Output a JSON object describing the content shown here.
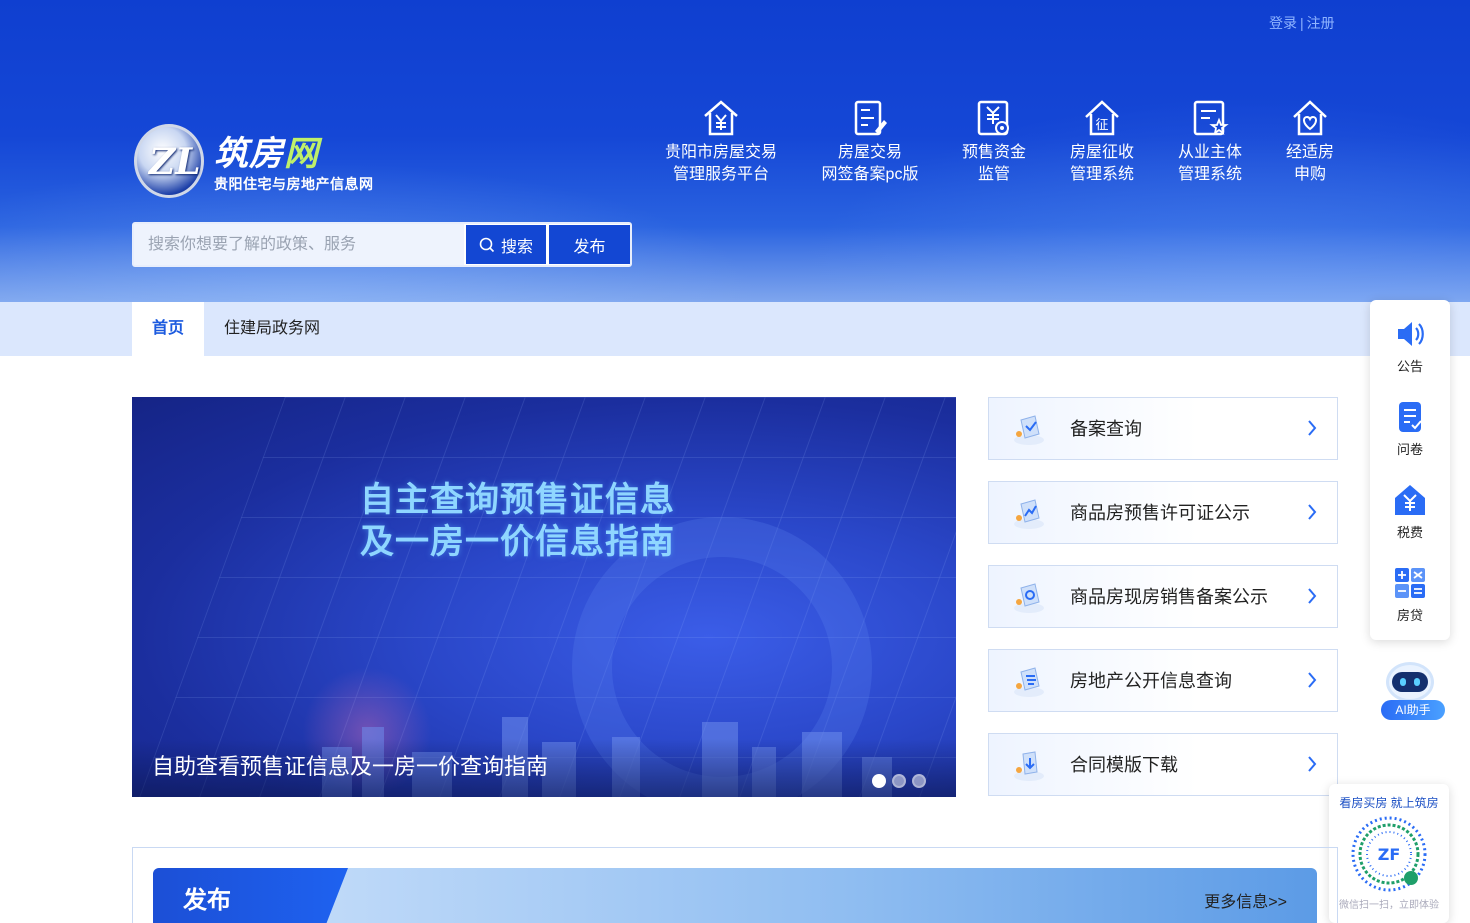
{
  "auth": {
    "login": "登录",
    "separator": "|",
    "register": "注册"
  },
  "logo": {
    "title_main": "筑房",
    "title_highlight": "网",
    "subtitle": "贵阳住宅与房地产信息网",
    "mark": "ZL"
  },
  "quick_nav": [
    {
      "line1": "贵阳市房屋交易",
      "line2": "管理服务平台",
      "icon": "house-yuan-icon"
    },
    {
      "line1": "房屋交易",
      "line2": "网签备案pc版",
      "icon": "contract-edit-icon"
    },
    {
      "line1": "预售资金",
      "line2": "监管",
      "icon": "fund-supervision-icon"
    },
    {
      "line1": "房屋征收",
      "line2": "管理系统",
      "icon": "house-levy-icon"
    },
    {
      "line1": "从业主体",
      "line2": "管理系统",
      "icon": "entity-star-icon"
    },
    {
      "line1": "经适房",
      "line2": "申购",
      "icon": "house-heart-icon"
    }
  ],
  "search": {
    "placeholder": "搜索你想要了解的政策、服务",
    "button": "搜索",
    "publish": "发布"
  },
  "nav": {
    "home": "首页",
    "gov": "住建局政务网"
  },
  "banner": {
    "headline1": "自主查询预售证信息",
    "headline2": "及一房一价信息指南",
    "caption": "自助查看预售证信息及一房一价查询指南",
    "slides": 3,
    "active_slide": 1
  },
  "services": [
    {
      "label": "备案查询",
      "icon": "record-search-icon"
    },
    {
      "label": "商品房预售许可证公示",
      "icon": "presale-permit-icon"
    },
    {
      "label": "商品房现房销售备案公示",
      "icon": "sales-record-icon"
    },
    {
      "label": "房地产公开信息查询",
      "icon": "public-info-icon"
    },
    {
      "label": "合同模版下载",
      "icon": "contract-download-icon"
    }
  ],
  "float_menu": [
    {
      "label": "公告",
      "icon": "speaker-icon"
    },
    {
      "label": "问卷",
      "icon": "survey-icon"
    },
    {
      "label": "税费",
      "icon": "tax-icon"
    },
    {
      "label": "房贷",
      "icon": "calculator-icon"
    }
  ],
  "ai": {
    "label": "AI助手"
  },
  "qr": {
    "title": "看房买房 就上筑房",
    "center": "ZF",
    "footer": "微信扫一扫，立即体验"
  },
  "publish_section": {
    "title": "发布",
    "more": "更多信息>>"
  },
  "colors": {
    "primary": "#1347d3",
    "nav_bg": "#dbe7fd",
    "active_tab": "#1b5adf"
  }
}
